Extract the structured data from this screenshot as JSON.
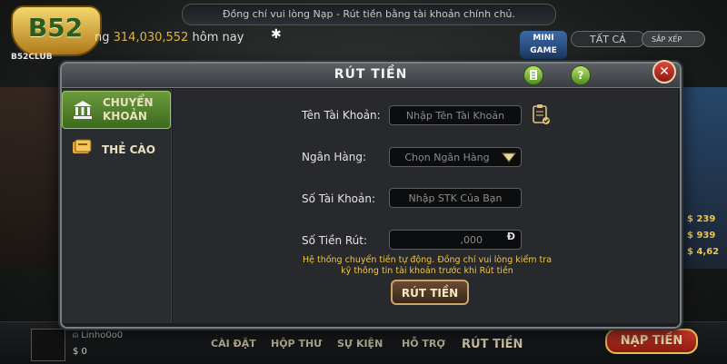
{
  "header": {
    "marquee": "Đồng chí vui lòng Nạp - Rút tiền bằng tài khoản chính chủ.",
    "logo_text": "B52",
    "logo_subtext": "B52CLUB",
    "jackpot_prefix": "ng",
    "jackpot_value": "314,030,552",
    "jackpot_suffix": "hôm nay",
    "minigame": "MINI GAME",
    "filter_all": "TẤT CẢ",
    "sort": "SẮP XẾP"
  },
  "side_amounts": [
    "$ 239",
    "$ 939",
    "$ 4,62"
  ],
  "modal": {
    "title": "RÚT TIỀN",
    "icons": [
      "document-icon",
      "help-icon",
      "close-icon"
    ],
    "help_label": "?",
    "close_label": "✕",
    "tabs": [
      {
        "label_line1": "CHUYỂN",
        "label_line2": "KHOẢN",
        "icon": "bank-icon",
        "active": true
      },
      {
        "label_line1": "THẺ CÀO",
        "label_line2": "",
        "icon": "card-icon",
        "active": false
      }
    ],
    "form": {
      "account_name_label": "Tên Tài Khoản:",
      "account_name_placeholder": "Nhập Tên Tài Khoản",
      "bank_label": "Ngân Hàng:",
      "bank_value": "Chọn Ngân Hàng",
      "account_number_label": "Số Tài Khoản:",
      "account_number_placeholder": "Nhập STK Của Bạn",
      "amount_label": "Số Tiền Rút:",
      "amount_value": ",000",
      "currency": "Đ",
      "note_line1": "Hệ thống chuyển tiền tự động. Đồng chí vui lòng kiểm tra",
      "note_line2": "kỹ thông tin tài khoản trước khi Rút tiền",
      "submit_label": "RÚT TIỀN"
    }
  },
  "footer": {
    "username": "Linho0o0",
    "balance": "$ 0",
    "nav": [
      "CÀI ĐẶT",
      "HỘP THƯ",
      "SỰ KIỆN",
      "HỖ TRỢ",
      "RÚT TIỀN"
    ],
    "deposit": "NẠP TIỀN"
  },
  "colors": {
    "accent_gold": "#f0c649",
    "tab_active_green": "#4f8d1e",
    "close_red": "#c1271d"
  }
}
